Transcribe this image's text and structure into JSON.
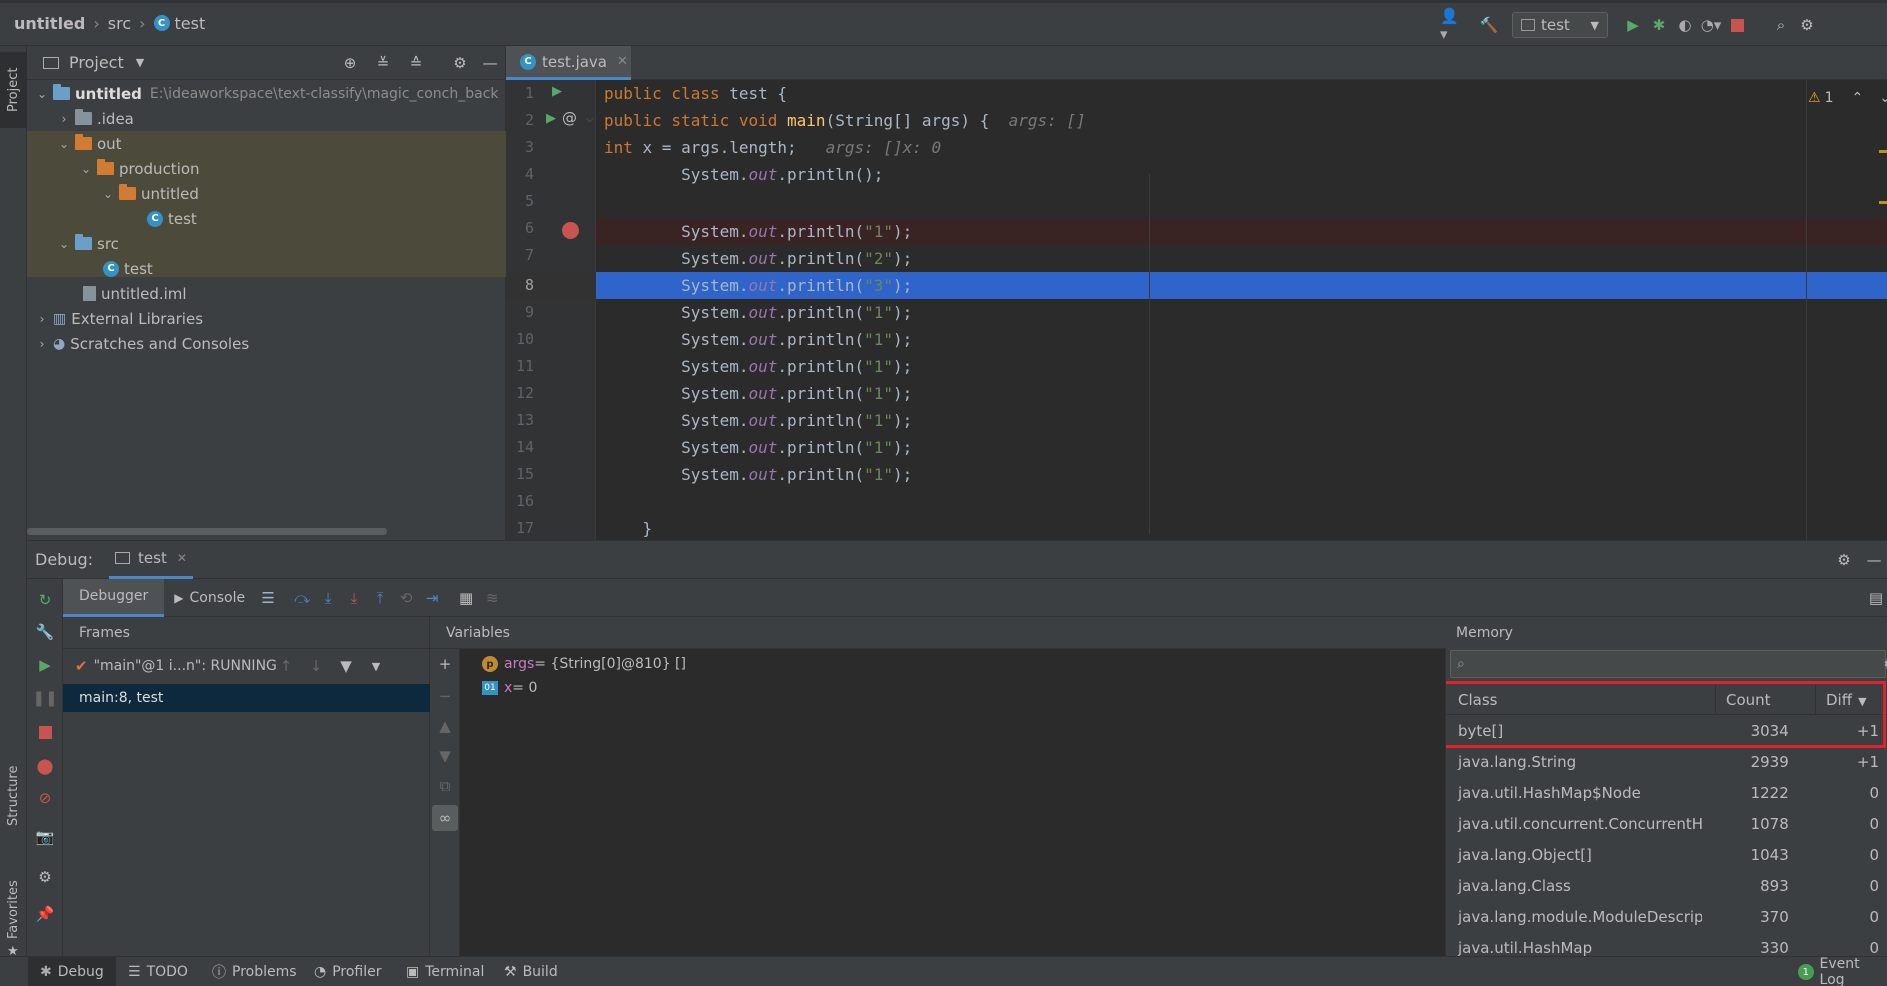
{
  "breadcrumb": {
    "project": "untitled",
    "folder": "src",
    "file": "test"
  },
  "toolbar": {
    "run_config": "test"
  },
  "project_panel": {
    "title": "Project",
    "tree": [
      {
        "label": "untitled",
        "path": "E:\\ideaworkspace\\text-classify\\magic_conch_back"
      },
      {
        "label": ".idea"
      },
      {
        "label": "out"
      },
      {
        "label": "production"
      },
      {
        "label": "untitled"
      },
      {
        "label": "test"
      },
      {
        "label": "src"
      },
      {
        "label": "test"
      },
      {
        "label": "untitled.iml"
      },
      {
        "label": "External Libraries"
      },
      {
        "label": "Scratches and Consoles"
      }
    ]
  },
  "editor": {
    "tab": "test.java",
    "warning_count": "1",
    "line_numbers": [
      "1",
      "2",
      "3",
      "4",
      "5",
      "6",
      "7",
      "8",
      "9",
      "10",
      "11",
      "12",
      "13",
      "14",
      "15",
      "16",
      "17"
    ],
    "hints": {
      "args_main": "args: []",
      "args_line3": "args: []",
      "x_line3": "x: 0"
    }
  },
  "debug": {
    "label": "Debug:",
    "session": "test",
    "tabs": {
      "debugger": "Debugger",
      "console": "Console"
    },
    "frames_title": "Frames",
    "thread": "\"main\"@1 i...n\": RUNNING",
    "frame": "main:8, test",
    "variables_title": "Variables",
    "variables": [
      {
        "name": "args",
        "value": " = {String[0]@810} []",
        "badge": "p"
      },
      {
        "name": "x",
        "value": " = 0",
        "badge": "01"
      }
    ],
    "memory": {
      "title": "Memory",
      "columns": [
        "Class",
        "Count",
        "Diff"
      ],
      "rows": [
        {
          "cls": "byte[]",
          "count": "3034",
          "diff": "+1"
        },
        {
          "cls": "java.lang.String",
          "count": "2939",
          "diff": "+1"
        },
        {
          "cls": "java.util.HashMap$Node",
          "count": "1222",
          "diff": "0"
        },
        {
          "cls": "java.util.concurrent.ConcurrentHas",
          "count": "1078",
          "diff": "0"
        },
        {
          "cls": "java.lang.Object[]",
          "count": "1043",
          "diff": "0"
        },
        {
          "cls": "java.lang.Class",
          "count": "893",
          "diff": "0"
        },
        {
          "cls": "java.lang.module.ModuleDescriptc",
          "count": "370",
          "diff": "0"
        },
        {
          "cls": "java.util.HashMap",
          "count": "330",
          "diff": "0"
        }
      ]
    }
  },
  "side_tabs": {
    "project": "Project",
    "structure": "Structure",
    "favorites": "Favorites"
  },
  "status_bar": {
    "tabs": [
      "Debug",
      "TODO",
      "Problems",
      "Profiler",
      "Terminal",
      "Build"
    ],
    "event_log": "Event Log",
    "event_count": "1"
  },
  "colors": {
    "accent": "#4a88c7",
    "selection": "#2f65ca",
    "breakpoint_line": "#3a2323",
    "highlight_border": "#e0232a"
  }
}
